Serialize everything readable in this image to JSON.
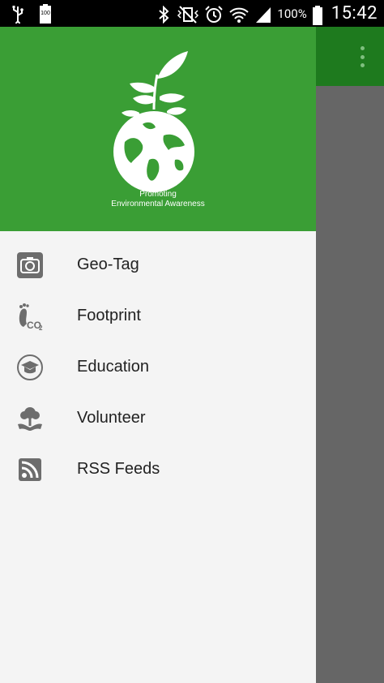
{
  "status_bar": {
    "left_icons": [
      "usb-icon",
      "battery-100-notification-icon"
    ],
    "battery_notification_text": "100",
    "right_icons": [
      "bluetooth-icon",
      "vibrate-icon",
      "alarm-icon",
      "wifi-icon",
      "signal-icon",
      "battery-icon"
    ],
    "battery_percent": "100%",
    "time": "15:42"
  },
  "drawer": {
    "header": {
      "bg_color": "#3a9e35",
      "tagline_line1": "Promoting",
      "tagline_line2": "Environmental Awareness"
    },
    "items": [
      {
        "label": "Geo-Tag",
        "icon": "camera-icon"
      },
      {
        "label": "Footprint",
        "icon": "co2-footprint-icon"
      },
      {
        "label": "Education",
        "icon": "graduation-cap-icon"
      },
      {
        "label": "Volunteer",
        "icon": "tree-hands-icon"
      },
      {
        "label": "RSS Feeds",
        "icon": "rss-icon"
      }
    ]
  },
  "app": {
    "toolbar_color": "#1e7a1e",
    "overflow_icon": "more-vert-icon"
  }
}
